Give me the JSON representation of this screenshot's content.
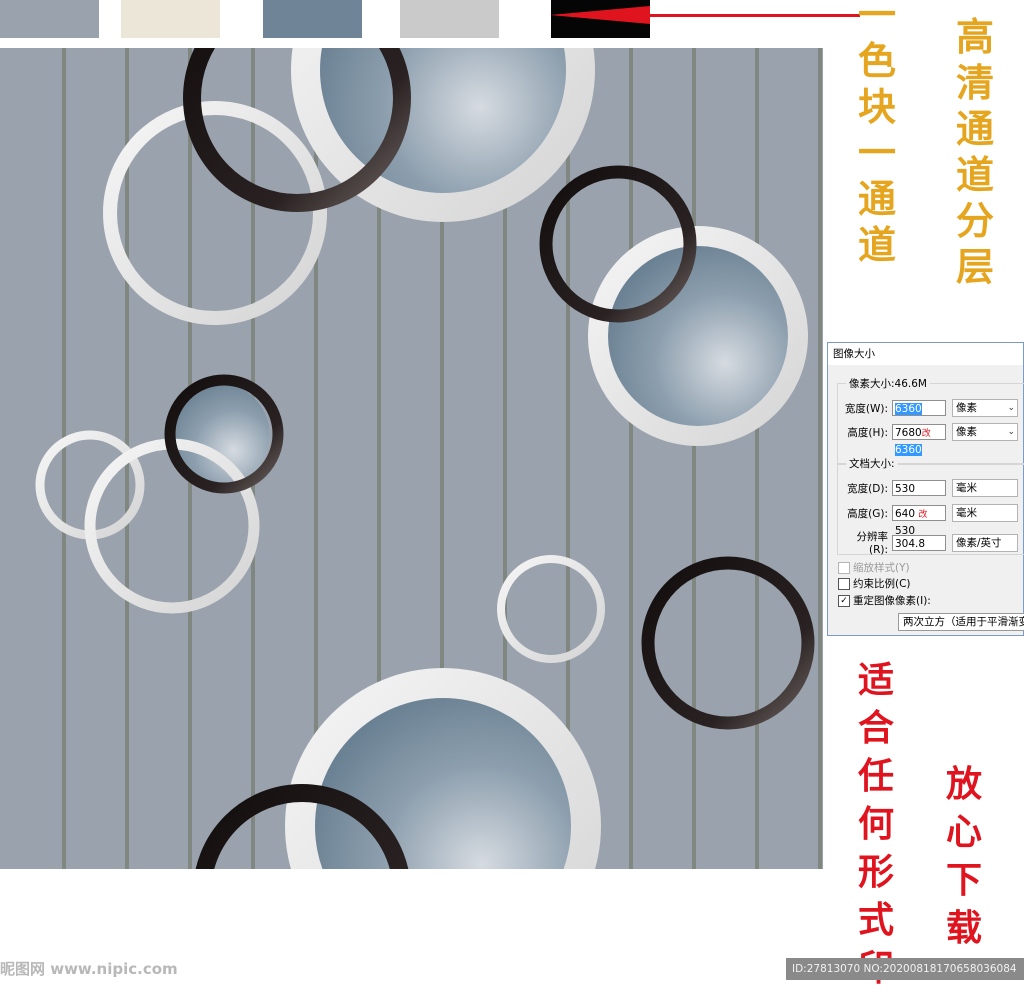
{
  "swatches": [
    {
      "name": "gray-swatch",
      "color": "#9aa3ad"
    },
    {
      "name": "beige-swatch",
      "color": "#ece6d8"
    },
    {
      "name": "slate-blue-swatch",
      "color": "#6f8597"
    },
    {
      "name": "light-gray-swatch",
      "color": "#cacaca"
    },
    {
      "name": "black-swatch",
      "color": "#050505"
    }
  ],
  "colors": {
    "pattern_bg": "#9aa3ad",
    "stripe": "#7f8780",
    "white_ring": "#e6e6e6",
    "black_ring": "#1a1414",
    "disc_blue": "#6f8597",
    "accent_red": "#e0141e",
    "accent_gold": "#e5a51f"
  },
  "captions": {
    "right_top": [
      "高",
      "清",
      "通",
      "道",
      "分",
      "层"
    ],
    "left_top": [
      "一",
      "色",
      "块",
      "一",
      "通",
      "道"
    ],
    "print": [
      "适",
      "合",
      "任",
      "何",
      "形",
      "式",
      "印"
    ],
    "download": [
      "放",
      "心",
      "下",
      "载"
    ]
  },
  "dialog": {
    "title": "图像大小",
    "pixel_dimensions_label": "像素大小:46.6M",
    "width_label": "宽度(W):",
    "width_value": "6360",
    "width_unit": "像素",
    "height_label": "高度(H):",
    "height_value_old": "7680",
    "height_mark": "改",
    "height_value": "6360",
    "height_unit": "像素",
    "doc_size_label": "文档大小:",
    "doc_width_label": "宽度(D):",
    "doc_width_value": "530",
    "doc_width_unit": "毫米",
    "doc_height_label": "高度(G):",
    "doc_height_value_old": "640",
    "doc_height_mark": "改",
    "doc_height_value": "530",
    "doc_height_unit": "毫米",
    "resolution_label": "分辨率(R):",
    "resolution_value": "304.8",
    "resolution_unit": "像素/英寸",
    "scale_styles": "缩放样式(Y)",
    "constrain": "约束比例(C)",
    "resample": "重定图像像素(I):",
    "resample_method": "两次立方（适用于平滑渐变"
  },
  "watermark": "昵图网 www.nipic.com",
  "id_text": "ID:27813070 NO:20200818170658036084"
}
